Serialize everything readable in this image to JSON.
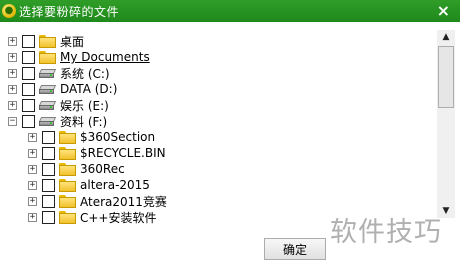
{
  "window": {
    "title": "选择要粉碎的文件",
    "close_glyph": "×"
  },
  "tree": {
    "items": [
      {
        "label": "桌面",
        "icon": "folder",
        "level": 0,
        "expander": "+"
      },
      {
        "label": "My Documents",
        "icon": "folder",
        "level": 0,
        "expander": "+"
      },
      {
        "label": "系统 (C:)",
        "icon": "drive",
        "level": 0,
        "expander": "+"
      },
      {
        "label": "DATA (D:)",
        "icon": "drive",
        "level": 0,
        "expander": "+"
      },
      {
        "label": "娱乐 (E:)",
        "icon": "drive",
        "level": 0,
        "expander": "+"
      },
      {
        "label": "资料 (F:)",
        "icon": "drive",
        "level": 0,
        "expander": "−"
      },
      {
        "label": "$360Section",
        "icon": "folder",
        "level": 1,
        "expander": "+"
      },
      {
        "label": "$RECYCLE.BIN",
        "icon": "folder",
        "level": 1,
        "expander": "+"
      },
      {
        "label": "360Rec",
        "icon": "folder",
        "level": 1,
        "expander": "+"
      },
      {
        "label": "altera-2015",
        "icon": "folder",
        "level": 1,
        "expander": "+"
      },
      {
        "label": "Atera2011竞赛",
        "icon": "folder",
        "level": 1,
        "expander": "+"
      },
      {
        "label": "C++安装软件",
        "icon": "folder",
        "level": 1,
        "expander": "+"
      }
    ]
  },
  "scrollbar": {
    "up_glyph": "▲",
    "down_glyph": "▼"
  },
  "footer": {
    "ok_label": "确定"
  },
  "watermark": {
    "text": "软件技巧"
  }
}
